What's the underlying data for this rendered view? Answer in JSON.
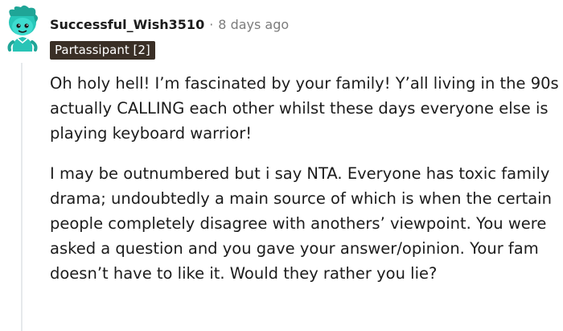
{
  "comment": {
    "username": "Successful_Wish3510",
    "separator": "·",
    "timestamp": "8 days ago",
    "flair": "Partassipant [2]",
    "avatar_icon": "snoo-avatar-icon",
    "paragraphs": [
      "Oh holy hell! I’m fascinated by your family! Y’all living in the 90s actually CALLING each other whilst these days everyone else is playing keyboard warrior!",
      "I may be outnumbered but i say NTA. Everyone has toxic family drama; undoubtedly a main source of which is when the certain people completely disagree with anothers’ viewpoint. You were asked a question and you gave your answer/opinion. Your fam doesn’t have to like it. Would they rather you lie?"
    ]
  },
  "colors": {
    "flair_bg": "#3a2f26",
    "avatar_teal": "#2fd1c4",
    "meta_gray": "#7c7c7c",
    "text": "#1c1c1c"
  }
}
